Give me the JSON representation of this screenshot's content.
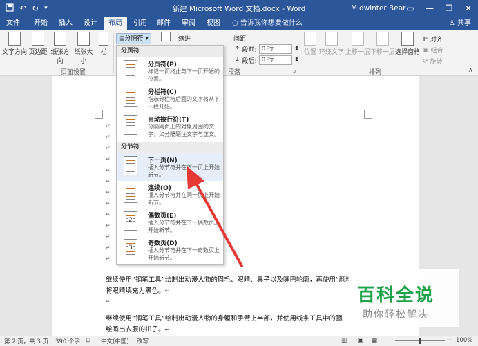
{
  "titlebar": {
    "title": "新建 Microsoft Word 文档.docx  -  Word",
    "user": "Midwinter Bear",
    "save_icon": "save-icon",
    "undo_icon": "undo-icon",
    "redo_icon": "redo-icon",
    "minimize": "—",
    "restore": "❐",
    "close": "✕",
    "ribbon_display": "▭",
    "color": "#2b579a"
  },
  "tabs": [
    {
      "label": "文件"
    },
    {
      "label": "开始"
    },
    {
      "label": "插入"
    },
    {
      "label": "设计"
    },
    {
      "label": "布局"
    },
    {
      "label": "引用"
    },
    {
      "label": "邮件"
    },
    {
      "label": "审阅"
    },
    {
      "label": "视图"
    }
  ],
  "tellme": "告诉我你想要做什么",
  "share": "共享",
  "ribbon": {
    "text_direction": "文字方向",
    "margins": "页边距",
    "orientation": "纸张方向",
    "size": "纸张大小",
    "columns": "栏",
    "breaks": "分隔符",
    "page_setup_group": "页面设置",
    "indent": "缩进",
    "spacing": "间距",
    "before_label": "段前:",
    "before_value": "0 行",
    "after_label": "段后:",
    "after_value": "0 行",
    "paragraph_group": "段落",
    "position": "位置",
    "wrap_text": "环绕文字",
    "bring_forward": "上移一层",
    "send_backward": "下移一层",
    "selection_pane": "选择窗格",
    "align": "对齐",
    "group": "组合",
    "rotate": "旋转",
    "arrange_group": "排列"
  },
  "dropdown": {
    "section1": "分页符",
    "section2": "分节符",
    "items": [
      {
        "name": "分页符(P)",
        "desc": "标记一页终止与下一页开始的位置。"
      },
      {
        "name": "分栏符(C)",
        "desc": "指示分栏符后面的文字将从下一栏开始。"
      },
      {
        "name": "自动换行符(T)",
        "desc": "分隔网页上的对象周围的文字，如分隔题注文字与正文。"
      },
      {
        "name": "下一页(N)",
        "desc": "插入分节符并在下一页上开始新节。"
      },
      {
        "name": "连续(O)",
        "desc": "插入分节符并在同一页上开始新节。"
      },
      {
        "name": "偶数页(E)",
        "desc": "插入分节符并在下一偶数页上开始新节。",
        "num": "2"
      },
      {
        "name": "奇数页(D)",
        "desc": "插入分节符并在下一奇数页上开始新节。",
        "num": "3"
      }
    ]
  },
  "document": {
    "para_mark": "↵",
    "line1": "继续使用“钢笔工具”绘制出动漫人物的眉毛、眼睛、鼻子以及嘴巴轮廓，再使用“颜料",
    "line2": "将眼睛填充为黑色。↵",
    "line3": "继续使用“钢笔工具”绘制出动漫人物的身躯和手臂上半部，并使用线条工具中的圆",
    "line4": "绘画出衣服的扣子。↵"
  },
  "statusbar": {
    "page": "第 2 页，共 3 页",
    "words": "390 个字",
    "language": "中文(中国)",
    "mode": "改写",
    "zoom_minus": "−",
    "zoom_plus": "+",
    "zoom": "100%",
    "zoom_level": 1.0
  },
  "watermark": {
    "line1": "百科全说",
    "line2": "助你轻松解决",
    "color": "#1fa34a"
  },
  "arrow_color": "#e53935"
}
